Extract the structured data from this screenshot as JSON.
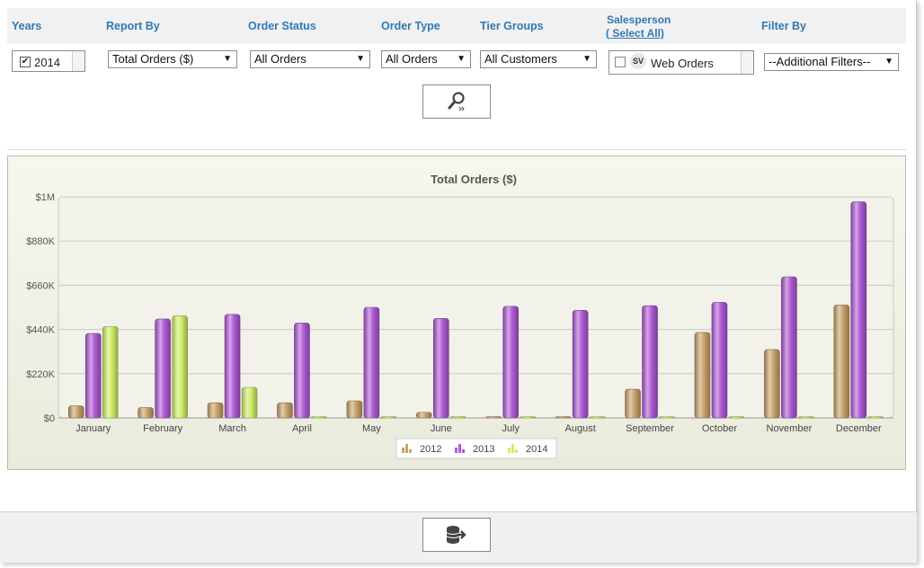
{
  "filters": {
    "years_label": "Years",
    "report_by_label": "Report By",
    "order_status_label": "Order Status",
    "order_type_label": "Order Type",
    "tier_groups_label": "Tier Groups",
    "salesperson_label": "Salesperson",
    "select_all_label": "( Select All)",
    "filter_by_label": "Filter By",
    "year_value": "2014",
    "report_by_value": "Total Orders ($)",
    "order_status_value": "All Orders",
    "order_type_value": "All Orders",
    "tier_groups_value": "All Customers",
    "salesperson_logo": "SV",
    "salesperson_value": "Web Orders",
    "filter_by_value": "--Additional Filters--"
  },
  "colors": {
    "label_blue": "#2f79b5",
    "series_2012": "#c8a36a",
    "series_2013": "#b05bd6",
    "series_2014": "#cfee6a"
  },
  "icons": {
    "search_button": "search-magnifier-icon",
    "export_button": "database-export-icon"
  },
  "chart_data": {
    "type": "bar",
    "title": "Total Orders ($)",
    "categories": [
      "January",
      "February",
      "March",
      "April",
      "May",
      "June",
      "July",
      "August",
      "September",
      "October",
      "November",
      "December"
    ],
    "series": [
      {
        "name": "2012",
        "color": "#c8a36a",
        "values": [
          60000,
          52000,
          75000,
          75000,
          85000,
          28000,
          2000,
          6000,
          143000,
          425000,
          340000,
          562000
        ]
      },
      {
        "name": "2013",
        "color": "#b05bd6",
        "values": [
          420000,
          492000,
          515000,
          472000,
          550000,
          495000,
          555000,
          535000,
          558000,
          575000,
          702000,
          1075000
        ]
      },
      {
        "name": "2014",
        "color": "#cfee6a",
        "values": [
          455000,
          508000,
          152000,
          0,
          0,
          0,
          0,
          0,
          0,
          0,
          0,
          0
        ]
      }
    ],
    "yticks": [
      0,
      220000,
      440000,
      660000,
      880000,
      1100000
    ],
    "ytick_labels": [
      "$0",
      "$220K",
      "$440K",
      "$660K",
      "$880K",
      "$1M"
    ],
    "ylim": [
      0,
      1100000
    ],
    "grid": true,
    "legend_position": "bottom-center"
  }
}
